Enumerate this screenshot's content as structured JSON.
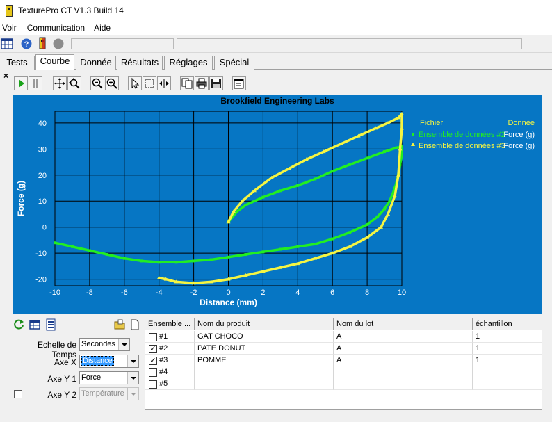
{
  "window": {
    "title": "TexturePro CT V1.3 Build 14"
  },
  "menu": [
    {
      "label": "Voir"
    },
    {
      "label": "Communication"
    },
    {
      "label": "Aide"
    }
  ],
  "tabs": [
    {
      "label": "Tests"
    },
    {
      "label": "Courbe",
      "active": true
    },
    {
      "label": "Donnée"
    },
    {
      "label": "Résultats"
    },
    {
      "label": "Réglages"
    },
    {
      "label": "Spécial"
    }
  ],
  "close_label": "×",
  "colors": {
    "chart_bg": "#0676c4",
    "plot_bg": "#0676c4",
    "grid": "#000000",
    "series2": "#22ee22",
    "series3": "#f5f542"
  },
  "chart_data": {
    "type": "line",
    "title": "Brookfield Engineering Labs",
    "xlabel": "Distance (mm)",
    "ylabel": "Force (g)",
    "xlim": [
      -10,
      10
    ],
    "ylim": [
      -22.5,
      44.5
    ],
    "xticks": [
      -10,
      -8,
      -6,
      -4,
      -2,
      0,
      2,
      4,
      6,
      8,
      10
    ],
    "yticks": [
      -20,
      -10,
      0,
      10,
      20,
      30,
      40
    ],
    "grid": true,
    "legend_header": {
      "file": "Fichier",
      "data": "Donnée"
    },
    "series": [
      {
        "name": "Ensemble de données #2",
        "data_label": "Force (g)",
        "color": "#22ee22",
        "points": [
          [
            0,
            2
          ],
          [
            0.5,
            6
          ],
          [
            1,
            8.5
          ],
          [
            2,
            11.5
          ],
          [
            3,
            14
          ],
          [
            4,
            16
          ],
          [
            5,
            18.5
          ],
          [
            6,
            21.5
          ],
          [
            7,
            24
          ],
          [
            8,
            26.5
          ],
          [
            9,
            29
          ],
          [
            9.7,
            30.5
          ],
          [
            10,
            31
          ],
          [
            10,
            28
          ],
          [
            9.9,
            24
          ],
          [
            9.8,
            20
          ],
          [
            9.6,
            15
          ],
          [
            9.3,
            10
          ],
          [
            9,
            7
          ],
          [
            8.6,
            4
          ],
          [
            8,
            1
          ],
          [
            7,
            -2
          ],
          [
            6,
            -4.5
          ],
          [
            5,
            -6.5
          ],
          [
            4,
            -7.5
          ],
          [
            3,
            -8.5
          ],
          [
            2,
            -9.5
          ],
          [
            1,
            -10.5
          ],
          [
            0,
            -11.5
          ],
          [
            -1,
            -12.5
          ],
          [
            -2,
            -13
          ],
          [
            -3,
            -13.5
          ],
          [
            -4,
            -13.5
          ],
          [
            -5,
            -13
          ],
          [
            -6,
            -12
          ],
          [
            -7,
            -10.5
          ],
          [
            -8,
            -9
          ],
          [
            -9,
            -7.5
          ],
          [
            -10,
            -6
          ]
        ]
      },
      {
        "name": "Ensemble de données #3",
        "data_label": "Force (g)",
        "color": "#f5f542",
        "points": [
          [
            0,
            2
          ],
          [
            0.3,
            6
          ],
          [
            0.8,
            10
          ],
          [
            1.5,
            14
          ],
          [
            2.5,
            19
          ],
          [
            3.5,
            22.5
          ],
          [
            4.5,
            26
          ],
          [
            5.5,
            29
          ],
          [
            6.5,
            32
          ],
          [
            7.5,
            35
          ],
          [
            8.5,
            38
          ],
          [
            9.2,
            40
          ],
          [
            9.8,
            42
          ],
          [
            10,
            43.5
          ],
          [
            10,
            38
          ],
          [
            9.9,
            30
          ],
          [
            9.8,
            20
          ],
          [
            9.6,
            12
          ],
          [
            9.2,
            5
          ],
          [
            8.8,
            0
          ],
          [
            8,
            -4
          ],
          [
            7,
            -7.5
          ],
          [
            6,
            -10
          ],
          [
            5,
            -12
          ],
          [
            4,
            -14
          ],
          [
            3,
            -15.5
          ],
          [
            2,
            -17
          ],
          [
            1,
            -18.5
          ],
          [
            0,
            -20
          ],
          [
            -1,
            -21
          ],
          [
            -2,
            -21.5
          ],
          [
            -3,
            -21
          ],
          [
            -3.6,
            -20
          ],
          [
            -4,
            -19.5
          ]
        ]
      }
    ]
  },
  "left_panel": {
    "time_scale_label": "Echelle de Temps",
    "time_scale_value": "Secondes",
    "axis_x_label": "Axe X",
    "axis_x_value": "Distance",
    "axis_y1_label": "Axe Y 1",
    "axis_y1_value": "Force",
    "axis_y2_label": "Axe Y 2",
    "axis_y2_value": "Température"
  },
  "grid": {
    "headers": [
      "Ensemble ...",
      "Nom du produit",
      "Nom du lot",
      "échantillon"
    ],
    "rows": [
      {
        "id": "#1",
        "checked": false,
        "product": "GAT CHOCO",
        "lot": "A",
        "sample": "1"
      },
      {
        "id": "#2",
        "checked": true,
        "product": "PATE DONUT",
        "lot": "A",
        "sample": "1"
      },
      {
        "id": "#3",
        "checked": true,
        "product": "POMME",
        "lot": "A",
        "sample": "1"
      },
      {
        "id": "#4",
        "checked": false,
        "product": "",
        "lot": "",
        "sample": ""
      },
      {
        "id": "#5",
        "checked": false,
        "product": "",
        "lot": "",
        "sample": ""
      }
    ]
  },
  "check_mark": "✓"
}
